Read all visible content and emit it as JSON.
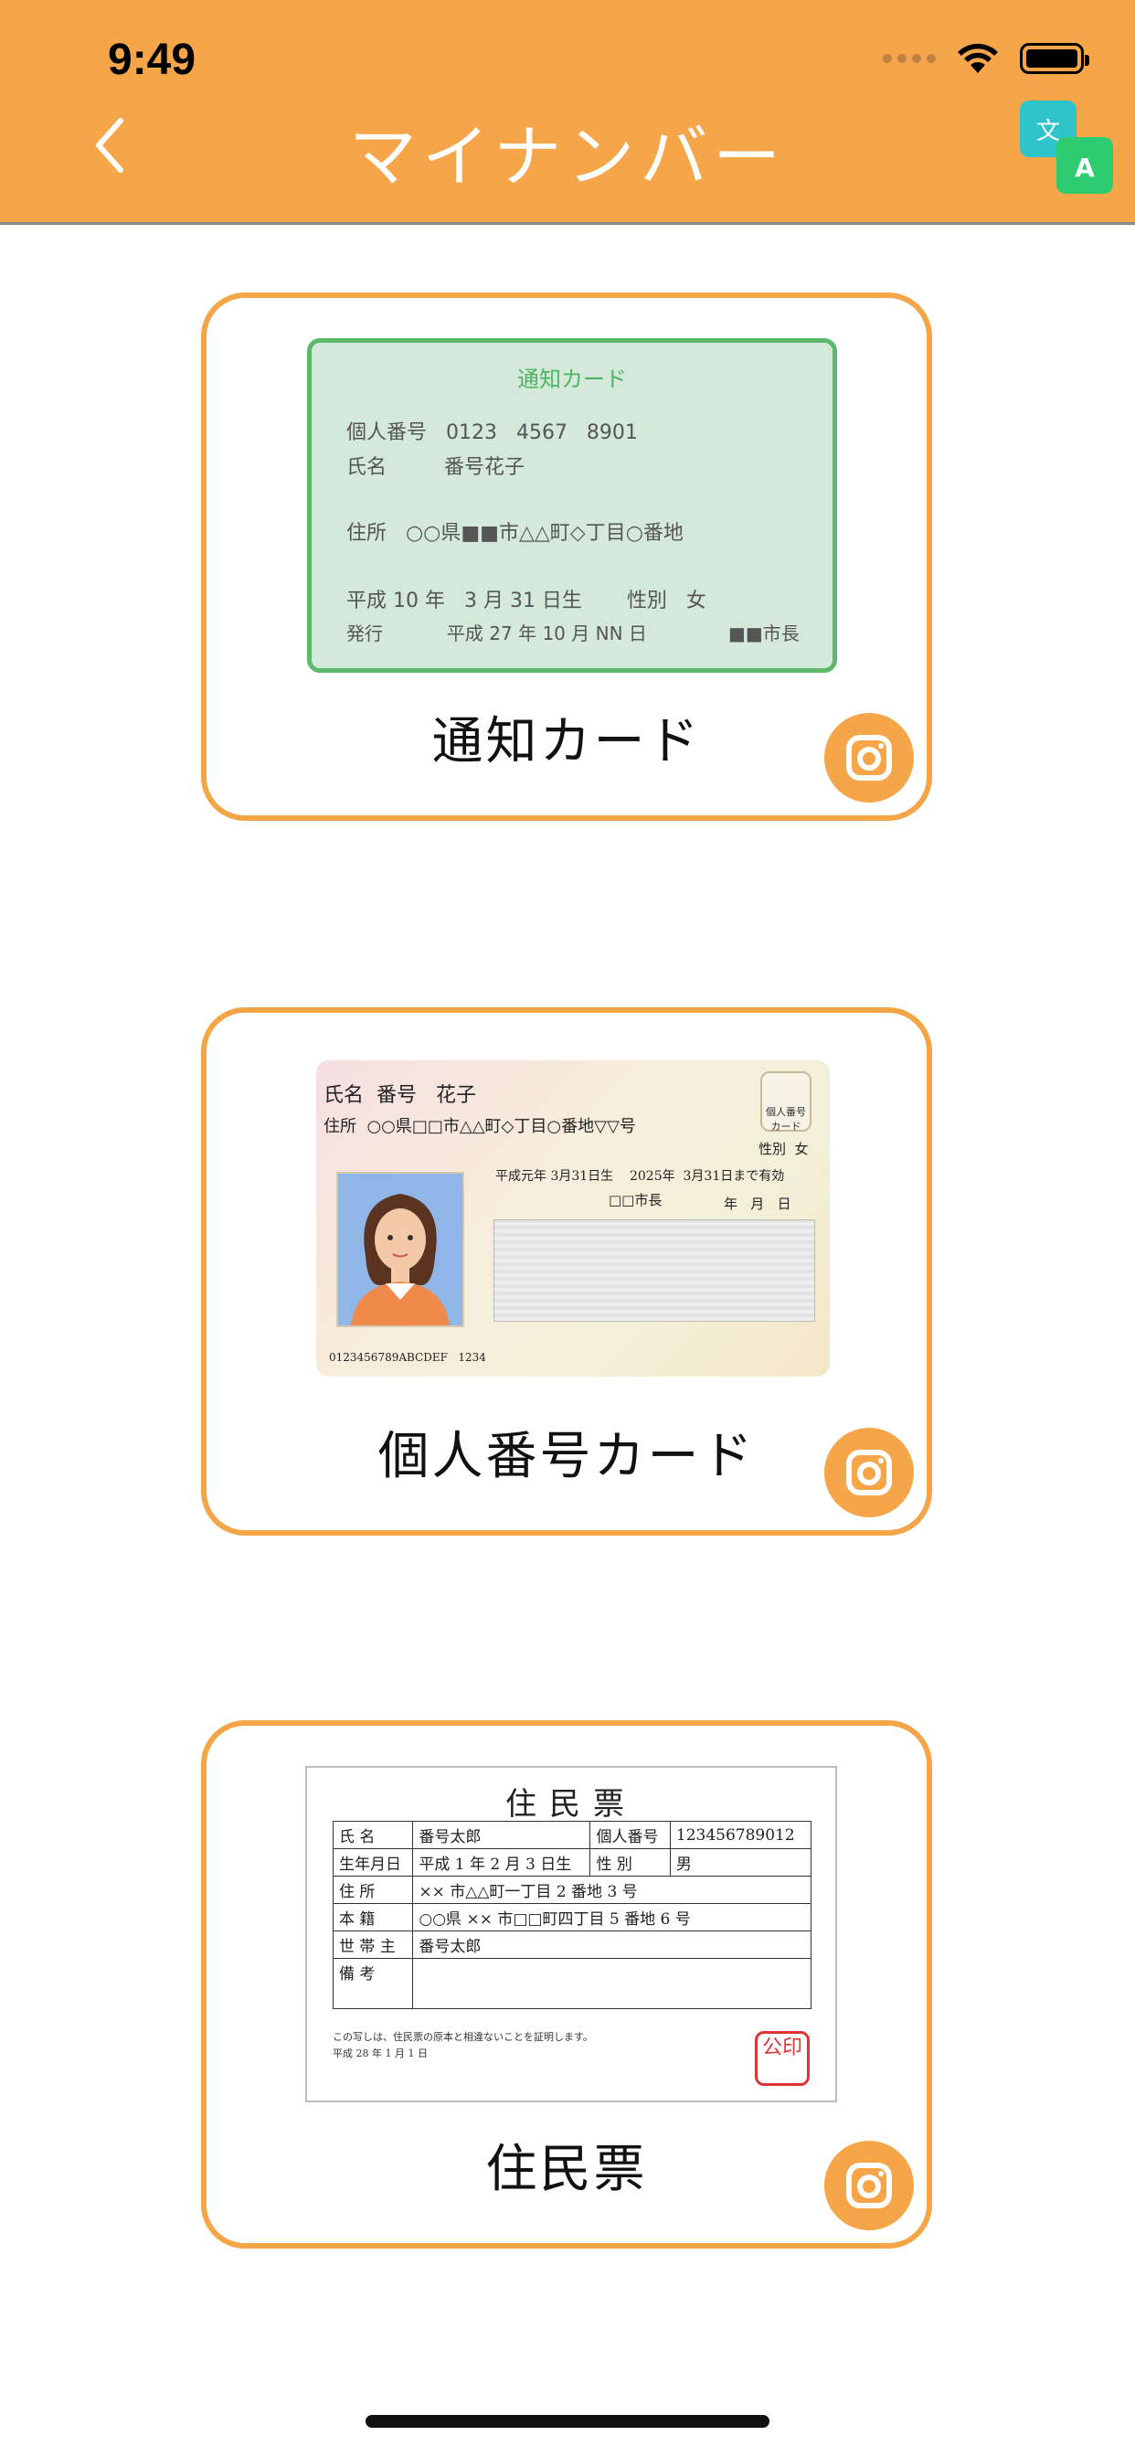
{
  "status_bar": {
    "time": "9:49"
  },
  "header": {
    "title": "マイナンバー",
    "back_icon": "chevron-left-icon",
    "translate_icon": "translate-icon"
  },
  "cards": [
    {
      "label": "通知カード",
      "camera_icon": "camera-icon"
    },
    {
      "label": "個人番号カード",
      "camera_icon": "camera-icon"
    },
    {
      "label": "住民票",
      "camera_icon": "camera-icon"
    }
  ],
  "notice_card": {
    "title": "通知カード",
    "rows": [
      "個人番号   0123   4567   8901",
      "氏名         番号花子",
      "住所   ○○県■■市△△町◇丁目○番地",
      "平成 10 年   3 月 31 日生       性別   女",
      "発行           平成 27 年 10 月 NN 日"
    ],
    "issuer": "■■市長"
  },
  "mynumber_card": {
    "name": "氏名  番号   花子",
    "address": "住所  ○○県□□市△△町◇丁目○番地▽▽号",
    "sex": "性別  女",
    "validity": "平成元年 3月31日生    2025年  3月31日まで有効",
    "issuer": "□□市長",
    "date_label": "年   月   日",
    "serial": "0123456789ABCDEF   1234",
    "emblem": "個人番号カード"
  },
  "residence": {
    "title": "住民票",
    "rows": [
      [
        "氏 名",
        "番号太郎",
        "個人番号",
        "123456789012"
      ],
      [
        "生年月日",
        "平成 1 年 2 月 3 日生",
        "性 別",
        "男"
      ],
      [
        "住 所",
        "×× 市△△町一丁目 2 番地 3 号",
        "",
        ""
      ],
      [
        "本 籍",
        "○○県 ×× 市□□町四丁目 5 番地 6 号",
        "",
        ""
      ],
      [
        "世 帯 主",
        "番号太郎",
        "",
        ""
      ],
      [
        "備 考",
        "",
        "",
        ""
      ]
    ],
    "note1": "この写しは、住民票の原本と相違ないことを証明します。",
    "note2": "平成 28 年 1 月 1 日",
    "seal": "公印"
  },
  "colors": {
    "accent": "#F7A549",
    "card_border": "#F3A547",
    "notice_green": "#5DBA6C"
  }
}
